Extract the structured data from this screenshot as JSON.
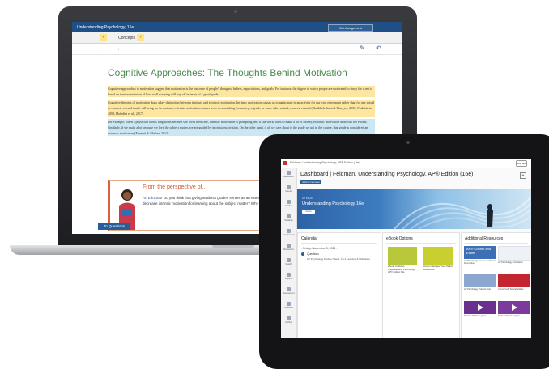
{
  "laptop": {
    "topbar_title": "Understanding Psychology, 16e",
    "topbar_button": "Get Assignment",
    "tab_label": "Concepts",
    "tab_prev": "‹",
    "tab_next": "›",
    "nav_back": "←",
    "nav_forward": "→",
    "nav_highlight": "✎",
    "nav_return": "↶",
    "heading": "Cognitive Approaches: The Thoughts Behind Motivation",
    "para1": "Cognitive approaches to motivation suggest that motivation is the outcome of people's thoughts, beliefs, expectations, and goals. For instance, the degree to which people are motivated to study for a test is based on their expectation of how well studying will pay off in terms of a good grade.",
    "para2": "Cognitive theories of motivation draw a key distinction between intrinsic and extrinsic motivation. Intrinsic motivation causes us to participate in an activity for our own enjoyment rather than for any actual or concrete reward that it will bring us. In contrast, extrinsic motivation causes us to do something for money, a grade, or some other actual, concrete reward (Shaikholeslami & Khayyer, 2006; Finkelstein, 2009; Hofeditz et al., 2017).",
    "para3": "For example, when a physician works long hours because she loves medicine, intrinsic motivation is prompting her; if she works hard to make a lot of money, extrinsic motivation underlies her efforts. Similarly, if we study a lot because we love the subject matter, we are guided by intrinsic motivation. On the other hand, if all we care about is the grade we get in the course, that grade is considered an extrinsic motivation (Emmett & McGee, 2013).",
    "perspective_title": "From the perspective of...",
    "perspective_who": "An Educator",
    "perspective_text": " Do you think that giving students grades serves as an external reward that may decrease intrinsic motivation for learning about the subject matter? Why or why not?",
    "bottom_button": "To Questions"
  },
  "tablet": {
    "crumb": "Feldman: Understanding Psychology, AP® Edition (16e)",
    "signin": "Log out",
    "title": "Dashboard | Feldman, Understanding Psychology, AP® Edition (16e)",
    "badge": "Add to Calendar",
    "add": "+",
    "hero_small": "AP Psych",
    "hero_course": "Understanding Psychology 16e",
    "hero_button": "Go to Course",
    "sidebar": [
      "Dashboard",
      "Course",
      "Grades",
      "Students",
      "Assignments",
      "Resources",
      "Search",
      "Reports",
      "Assessment",
      "Calendar",
      "Archive"
    ],
    "calendar_title": "Calendar",
    "calendar_date": "‹  Friday, November 8, 2024  ›",
    "calendar_day": "Questions",
    "calendar_event": "AP Psychology Module Check: Ch 4 Learning & Motivation",
    "ebook_title": "eBook Options",
    "ebooks": [
      {
        "label": "eBook: Feldman, Understanding Psychology, AP® Edition 16e",
        "color": "#b9c73a"
      },
      {
        "label": "How to Navigate Your Digital Resources",
        "color": "#c9cf2f"
      }
    ],
    "resources_title": "Additional Resources",
    "resources": [
      {
        "label": "AP Psychology Course and Exam Description",
        "color": "#3c6fb3",
        "thumb": "AP® Course and Exam"
      },
      {
        "label": "AP Psychology Correlation",
        "color": "#eef1f5",
        "thumb": ""
      },
      {
        "label": "AP Psychology Practice Test",
        "color": "#8ba6cf",
        "thumb": ""
      },
      {
        "label": "Connect AP Tutorial Videos",
        "color": "#c3262f",
        "thumb": ""
      },
      {
        "label": "Teacher Digital Support",
        "color": "#6b2f8f",
        "thumb": ""
      },
      {
        "label": "Student Digital Support",
        "color": "#7c3a9a",
        "thumb": ""
      }
    ]
  }
}
